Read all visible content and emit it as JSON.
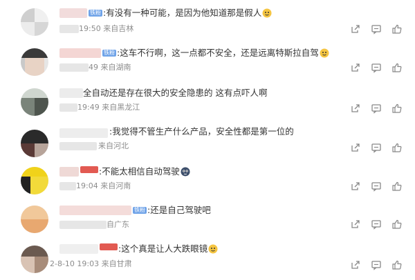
{
  "comments": [
    {
      "badge": "铁粉",
      "badge_color": "blue",
      "text": ":有没有一种可能，是因为他知道那是假人",
      "time": "19:50",
      "source": "来自吉林",
      "emoji": "doge"
    },
    {
      "badge": "铁粉",
      "badge_color": "blue",
      "text": ":这车不行啊，这一点都不安全，还是远离特斯拉自驾",
      "time": "49",
      "source": "来自湖南",
      "emoji": "doge"
    },
    {
      "badge": "",
      "badge_color": "",
      "text": "全自动还是存在很大的安全隐患的 这有点吓人啊",
      "time": "19:49",
      "source": "来自黑龙江",
      "emoji": ""
    },
    {
      "badge": "",
      "badge_color": "",
      "text": ":我觉得不管生产什么产品，安全性都是第一位的",
      "time": "",
      "source": "来自河北",
      "emoji": ""
    },
    {
      "badge": "",
      "badge_color": "red",
      "text": ":不能太相信自动驾驶",
      "time": "19:04",
      "source": "来自河南",
      "emoji": "dizzy"
    },
    {
      "badge": "铁粉",
      "badge_color": "blue",
      "text": ":还是自己驾驶吧",
      "time": "",
      "source": "自广东",
      "emoji": ""
    },
    {
      "badge": "",
      "badge_color": "red",
      "text": ":这个真是让人大跌眼镜",
      "time": "2-8-10 19:03",
      "source": "来自甘肃",
      "emoji": "doge"
    }
  ],
  "icons": {
    "share": "share-icon",
    "comment": "comment-icon",
    "like": "like-icon"
  }
}
